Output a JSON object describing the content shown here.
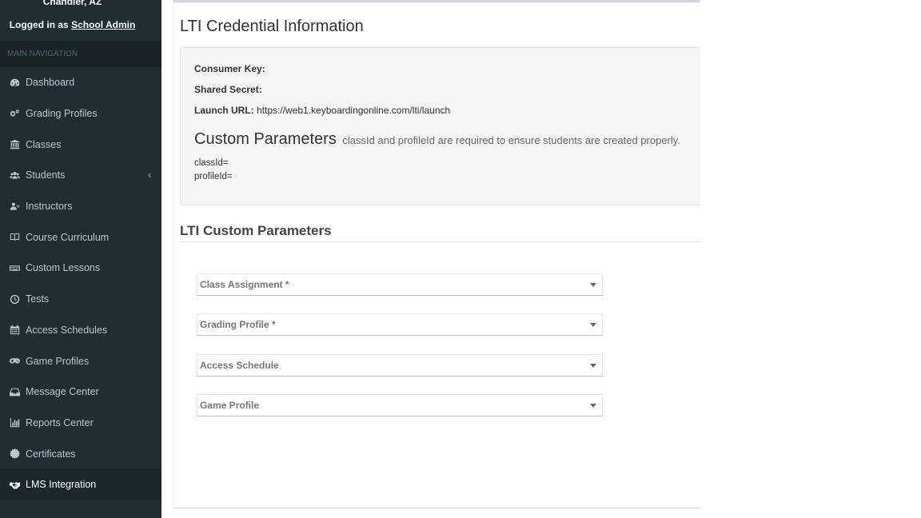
{
  "user": {
    "location": "Chandler, AZ",
    "logged_in_prefix": "Logged in as",
    "username": "School Admin"
  },
  "nav": {
    "header": "MAIN NAVIGATION",
    "items": [
      {
        "label": "Dashboard",
        "icon": "dashboard-icon"
      },
      {
        "label": "Grading Profiles",
        "icon": "gears-icon"
      },
      {
        "label": "Classes",
        "icon": "institution-icon"
      },
      {
        "label": "Students",
        "icon": "users-icon",
        "chevron": "‹"
      },
      {
        "label": "Instructors",
        "icon": "instructor-icon"
      },
      {
        "label": "Course Curriculum",
        "icon": "book-icon"
      },
      {
        "label": "Custom Lessons",
        "icon": "keyboard-icon"
      },
      {
        "label": "Tests",
        "icon": "clock-icon"
      },
      {
        "label": "Access Schedules",
        "icon": "calendar-icon"
      },
      {
        "label": "Game Profiles",
        "icon": "gamepad-icon"
      },
      {
        "label": "Message Center",
        "icon": "inbox-icon"
      },
      {
        "label": "Reports Center",
        "icon": "bar-chart-icon"
      },
      {
        "label": "Certificates",
        "icon": "certificate-icon"
      },
      {
        "label": "LMS Integration",
        "icon": "handshake-icon",
        "active": true
      }
    ]
  },
  "page": {
    "title": "LTI Credential Information",
    "consumer_key_label": "Consumer Key:",
    "consumer_key_value": "",
    "shared_secret_label": "Shared Secret:",
    "shared_secret_value": "",
    "launch_url_label": "Launch URL:",
    "launch_url_value": "https://web1.keyboardingonline.com/lti/launch",
    "custom_params_title": "Custom Parameters",
    "custom_params_note": "classId and profileId are required to ensure students are created properly.",
    "param_class": "classId=",
    "param_profile": "profileId=",
    "section_title": "LTI Custom Parameters"
  },
  "selects": {
    "class_assignment": "Class Assignment *",
    "grading_profile": "Grading Profile *",
    "access_schedule": "Access Schedule",
    "game_profile": "Game Profile"
  },
  "colors": {
    "sidebar_bg": "#222d32",
    "sidebar_header_bg": "#1a2226",
    "sidebar_text": "#b8c7ce",
    "active_item_bg": "#1e282c"
  }
}
